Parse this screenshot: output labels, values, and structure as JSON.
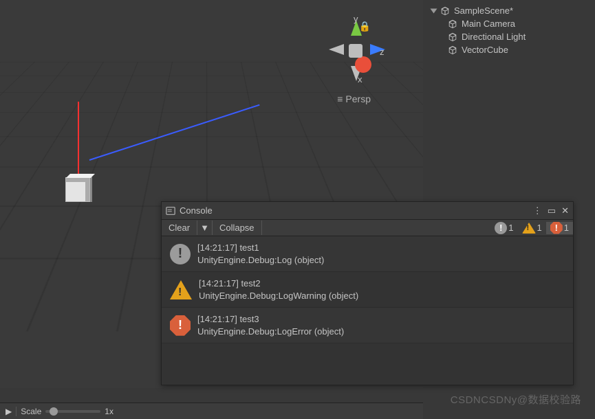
{
  "hierarchy": {
    "scene": "SampleScene*",
    "items": [
      "Main Camera",
      "Directional Light",
      "VectorCube"
    ]
  },
  "gizmo": {
    "y": "y",
    "x": "x",
    "z": "z",
    "persp": "Persp"
  },
  "console": {
    "title": "Console",
    "clear": "Clear",
    "collapse": "Collapse",
    "dropdown_glyph": "▼",
    "menu_glyph": "⋮",
    "max_glyph": "▭",
    "close_glyph": "✕",
    "counts": {
      "info": "1",
      "warn": "1",
      "error": "1"
    },
    "entries": [
      {
        "type": "info",
        "line1": "[14:21:17] test1",
        "line2": "UnityEngine.Debug:Log (object)"
      },
      {
        "type": "warn",
        "line1": "[14:21:17] test2",
        "line2": "UnityEngine.Debug:LogWarning (object)"
      },
      {
        "type": "error",
        "line1": "[14:21:17] test3",
        "line2": "UnityEngine.Debug:LogError (object)"
      }
    ]
  },
  "toolbar": {
    "scale_label": "Scale",
    "scale_value": "1x",
    "play_glyph": "▶"
  },
  "watermark": "CSDNCSDNy@数据校验路"
}
